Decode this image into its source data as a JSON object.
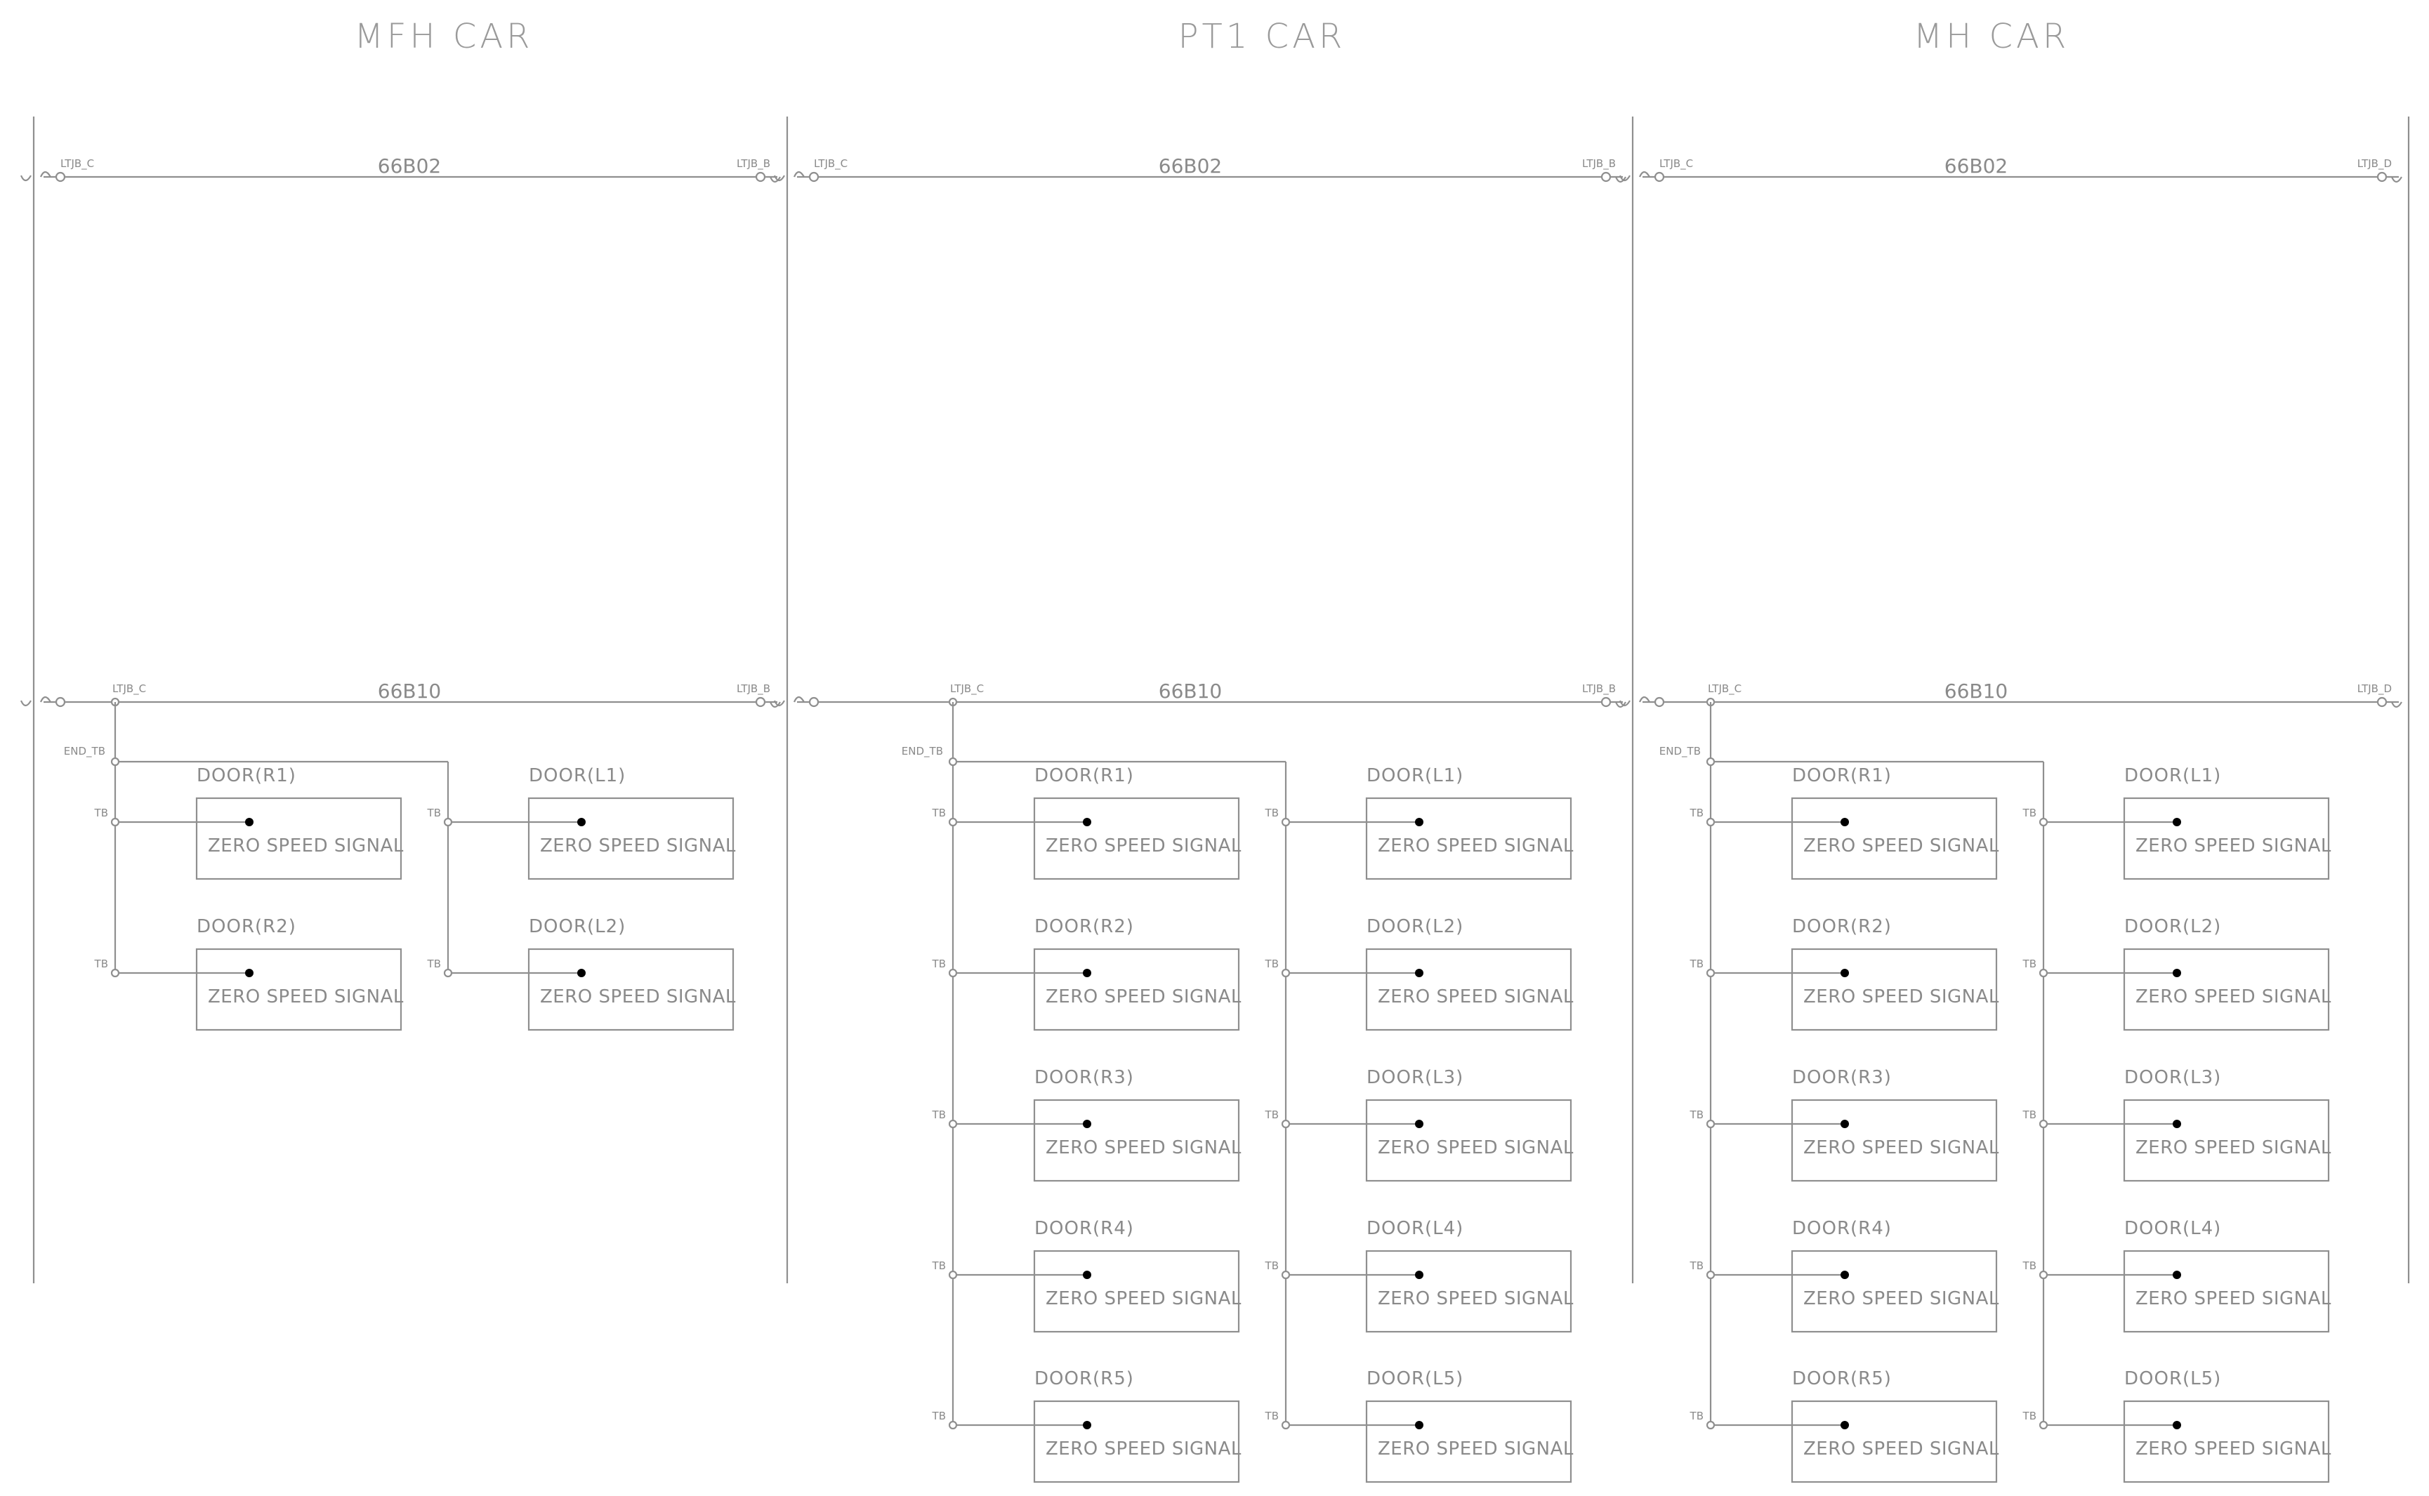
{
  "cars": [
    {
      "title": "MFH CAR",
      "bus_upper": {
        "label": "66B02",
        "left_tag": "LTJB_C",
        "right_tag": "LTJB_B"
      },
      "bus_lower": {
        "label": "66B10",
        "left_tag": "LTJB_C",
        "right_tag": "LTJB_B"
      },
      "end_tag": "END_TB",
      "right_doors": [
        {
          "label": "DOOR(R1)",
          "signal": "ZERO SPEED SIGNAL",
          "tag": "TB"
        },
        {
          "label": "DOOR(R2)",
          "signal": "ZERO SPEED SIGNAL",
          "tag": "TB"
        }
      ],
      "left_doors": [
        {
          "label": "DOOR(L1)",
          "signal": "ZERO SPEED SIGNAL",
          "tag": "TB"
        },
        {
          "label": "DOOR(L2)",
          "signal": "ZERO SPEED SIGNAL",
          "tag": "TB"
        }
      ]
    },
    {
      "title": "PT1 CAR",
      "bus_upper": {
        "label": "66B02",
        "left_tag": "LTJB_C",
        "right_tag": "LTJB_B"
      },
      "bus_lower": {
        "label": "66B10",
        "left_tag": "LTJB_C",
        "right_tag": "LTJB_B"
      },
      "end_tag": "END_TB",
      "right_doors": [
        {
          "label": "DOOR(R1)",
          "signal": "ZERO SPEED SIGNAL",
          "tag": "TB"
        },
        {
          "label": "DOOR(R2)",
          "signal": "ZERO SPEED SIGNAL",
          "tag": "TB"
        },
        {
          "label": "DOOR(R3)",
          "signal": "ZERO SPEED SIGNAL",
          "tag": "TB"
        },
        {
          "label": "DOOR(R4)",
          "signal": "ZERO SPEED SIGNAL",
          "tag": "TB"
        },
        {
          "label": "DOOR(R5)",
          "signal": "ZERO SPEED SIGNAL",
          "tag": "TB"
        }
      ],
      "left_doors": [
        {
          "label": "DOOR(L1)",
          "signal": "ZERO SPEED SIGNAL",
          "tag": "TB"
        },
        {
          "label": "DOOR(L2)",
          "signal": "ZERO SPEED SIGNAL",
          "tag": "TB"
        },
        {
          "label": "DOOR(L3)",
          "signal": "ZERO SPEED SIGNAL",
          "tag": "TB"
        },
        {
          "label": "DOOR(L4)",
          "signal": "ZERO SPEED SIGNAL",
          "tag": "TB"
        },
        {
          "label": "DOOR(L5)",
          "signal": "ZERO SPEED SIGNAL",
          "tag": "TB"
        }
      ]
    },
    {
      "title": "MH CAR",
      "bus_upper": {
        "label": "66B02",
        "left_tag": "LTJB_C",
        "right_tag": "LTJB_D"
      },
      "bus_lower": {
        "label": "66B10",
        "left_tag": "LTJB_C",
        "right_tag": "LTJB_D"
      },
      "end_tag": "END_TB",
      "right_doors": [
        {
          "label": "DOOR(R1)",
          "signal": "ZERO SPEED SIGNAL",
          "tag": "TB"
        },
        {
          "label": "DOOR(R2)",
          "signal": "ZERO SPEED SIGNAL",
          "tag": "TB"
        },
        {
          "label": "DOOR(R3)",
          "signal": "ZERO SPEED SIGNAL",
          "tag": "TB"
        },
        {
          "label": "DOOR(R4)",
          "signal": "ZERO SPEED SIGNAL",
          "tag": "TB"
        },
        {
          "label": "DOOR(R5)",
          "signal": "ZERO SPEED SIGNAL",
          "tag": "TB"
        }
      ],
      "left_doors": [
        {
          "label": "DOOR(L1)",
          "signal": "ZERO SPEED SIGNAL",
          "tag": "TB"
        },
        {
          "label": "DOOR(L2)",
          "signal": "ZERO SPEED SIGNAL",
          "tag": "TB"
        },
        {
          "label": "DOOR(L3)",
          "signal": "ZERO SPEED SIGNAL",
          "tag": "TB"
        },
        {
          "label": "DOOR(L4)",
          "signal": "ZERO SPEED SIGNAL",
          "tag": "TB"
        },
        {
          "label": "DOOR(L5)",
          "signal": "ZERO SPEED SIGNAL",
          "tag": "TB"
        }
      ]
    }
  ]
}
